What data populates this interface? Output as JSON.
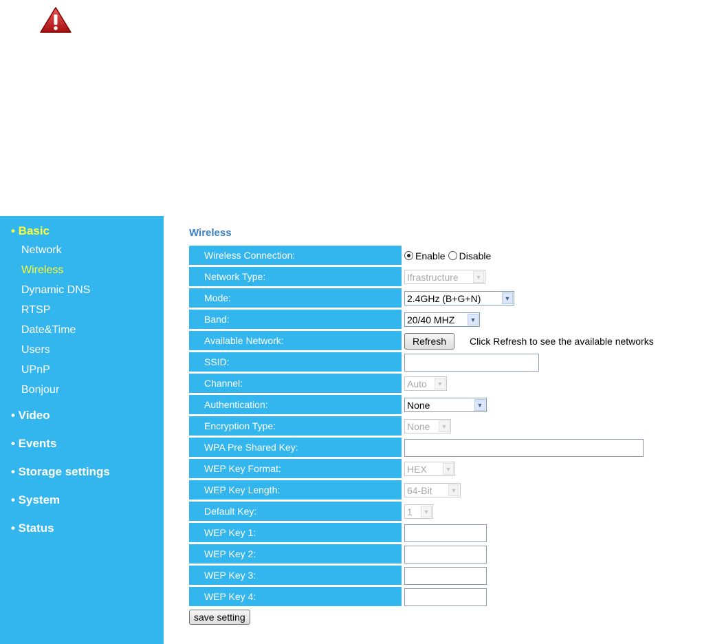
{
  "sidebar": {
    "basic_label": "• Basic",
    "basic_items": [
      "Network",
      "Wireless",
      "Dynamic DNS",
      "RTSP",
      "Date&Time",
      "Users",
      "UPnP",
      "Bonjour"
    ],
    "video_label": "• Video",
    "events_label": "• Events",
    "storage_label": "• Storage settings",
    "system_label": "• System",
    "status_label": "• Status"
  },
  "main": {
    "title": "Wireless",
    "labels": {
      "wireless_connection": "Wireless Connection:",
      "network_type": "Network Type:",
      "mode": "Mode:",
      "band": "Band:",
      "available_network": "Available Network:",
      "ssid": "SSID:",
      "channel": "Channel:",
      "authentication": "Authentication:",
      "encryption_type": "Encryption Type:",
      "wpa_key": "WPA Pre Shared Key:",
      "wep_format": "WEP Key Format:",
      "wep_length": "WEP Key Length:",
      "default_key": "Default Key:",
      "wep_key_1": "WEP Key 1:",
      "wep_key_2": "WEP Key 2:",
      "wep_key_3": "WEP Key 3:",
      "wep_key_4": "WEP Key 4:"
    },
    "values": {
      "enable_label": "Enable",
      "disable_label": "Disable",
      "network_type": "Ifrastructure",
      "mode": "2.4GHz (B+G+N)",
      "band": "20/40 MHZ",
      "refresh_label": "Refresh",
      "refresh_hint": "Click Refresh to see the available networks",
      "ssid": "",
      "channel": "Auto",
      "authentication": "None",
      "encryption_type": "None",
      "wpa_key": "",
      "wep_format": "HEX",
      "wep_length": "64-Bit",
      "default_key": "1",
      "wep_key_1": "",
      "wep_key_2": "",
      "wep_key_3": "",
      "wep_key_4": ""
    },
    "save_label": "save setting"
  }
}
